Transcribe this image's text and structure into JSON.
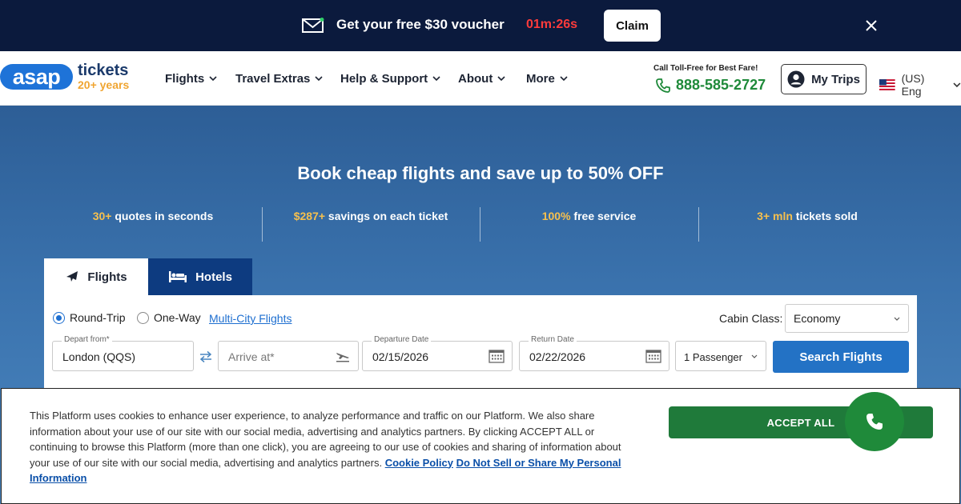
{
  "promo": {
    "title": "Get your free $30 voucher",
    "timer": "01m:26s",
    "claim_label": "Claim",
    "mail_icon": "envelope-icon",
    "close_icon": "close-icon"
  },
  "header": {
    "logo": {
      "asap": "asap",
      "tickets": "tickets",
      "years": "20+ years"
    },
    "nav": [
      {
        "label": "Flights"
      },
      {
        "label": "Travel Extras"
      },
      {
        "label": "Help & Support"
      },
      {
        "label": "About"
      },
      {
        "label": "More"
      }
    ],
    "tollfree_label": "Call Toll-Free for Best Fare!",
    "phone": "888-585-2727",
    "mytrips_label": "My Trips",
    "language": "(US) Eng"
  },
  "hero": {
    "title": "Book cheap flights and save up to 50% OFF",
    "stats": [
      {
        "highlight": "30+",
        "text": " quotes in seconds"
      },
      {
        "highlight": "$287+",
        "text": " savings on each ticket"
      },
      {
        "highlight": "100%",
        "text": " free service"
      },
      {
        "highlight": "3+ mln",
        "text": " tickets sold"
      }
    ]
  },
  "tabs": [
    {
      "label": "Flights",
      "active": true
    },
    {
      "label": "Hotels",
      "active": false
    }
  ],
  "search": {
    "trip_types": [
      {
        "label": "Round-Trip",
        "selected": true
      },
      {
        "label": "One-Way",
        "selected": false
      }
    ],
    "multicity_label": "Multi-City Flights",
    "cabin_label": "Cabin Class:",
    "cabin_value": "Economy",
    "depart_label": "Depart from*",
    "depart_value": "London (QQS)",
    "arrive_placeholder": "Arrive at*",
    "departure_date_label": "Departure Date",
    "departure_date_value": "02/15/2026",
    "return_date_label": "Return Date",
    "return_date_value": "02/22/2026",
    "passengers": "1 Passenger",
    "submit_label": "Search Flights"
  },
  "cookie": {
    "text": "This Platform uses cookies to enhance user experience, to analyze performance and traffic on our Platform. We also share information about your use of our site with our social media, advertising and analytics partners. By clicking ACCEPT ALL or continuing to browse this Platform (more than one click), you are agreeing to our use of cookies and sharing of information about your use of our site with our social media, advertising and analytics partners.",
    "policy_link": "Cookie Policy",
    "donotsell_link": "Do Not Sell or Share My Personal Information",
    "accept_label": "ACCEPT ALL"
  },
  "colors": {
    "banner_bg": "#0b1a3d",
    "timer_red": "#ff3b3b",
    "brand_blue": "#1e73d8",
    "phone_green": "#1f8a3a",
    "stat_highlight": "#f6c04e",
    "hotels_tab": "#0d3b80",
    "search_button": "#2372c5",
    "accept_green": "#1f7a3a"
  }
}
